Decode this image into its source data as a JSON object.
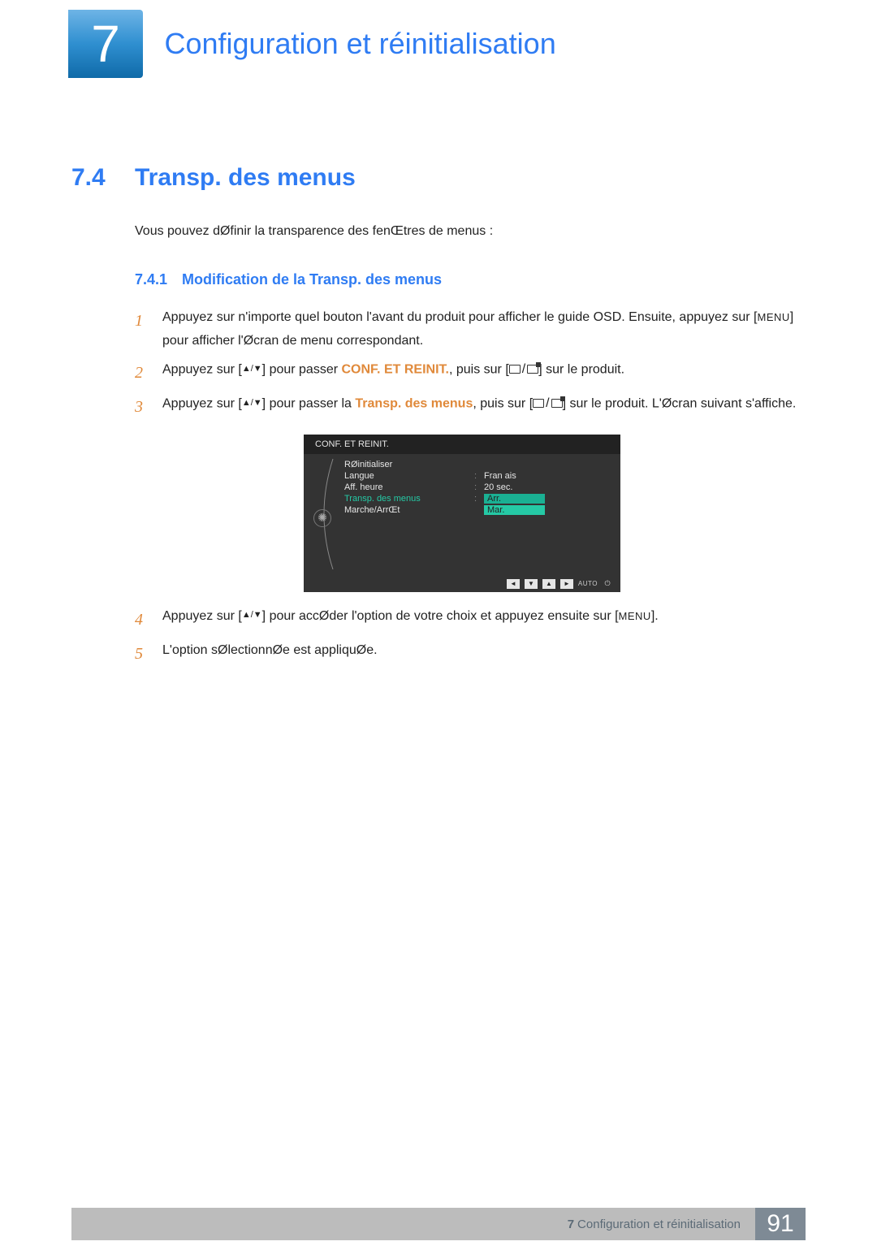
{
  "chapter": {
    "number": "7",
    "title": "Configuration et réinitialisation"
  },
  "section": {
    "number": "7.4",
    "title": "Transp. des menus",
    "intro": "Vous pouvez dØfinir la transparence des fenŒtres de menus :"
  },
  "subsection": {
    "number": "7.4.1",
    "title": "Modification de la Transp. des menus"
  },
  "steps": {
    "s1": {
      "num": "1",
      "a": "Appuyez sur n'importe quel bouton   l'avant du produit pour afficher le guide OSD. Ensuite, appuyez sur [",
      "menu": "MENU",
      "b": "] pour afficher l'Øcran de menu correspondant."
    },
    "s2": {
      "num": "2",
      "a": "Appuyez sur [",
      "b": "] pour passer   ",
      "orange": "CONF. ET REINIT.",
      "c": ", puis sur [",
      "d": "] sur le produit."
    },
    "s3": {
      "num": "3",
      "a": "Appuyez sur [",
      "b": "] pour passer   la ",
      "orange": "Transp. des menus",
      "c": ", puis sur [",
      "d": "] sur le produit. L'Øcran suivant s'affiche."
    },
    "s4": {
      "num": "4",
      "a": "Appuyez sur [",
      "b": "] pour accØder   l'option de votre choix et appuyez ensuite sur [",
      "menu": "MENU",
      "c": "]."
    },
    "s5": {
      "num": "5",
      "text": "L'option sØlectionnØe est appliquØe."
    }
  },
  "osd": {
    "header": "CONF. ET REINIT.",
    "items": {
      "reset": "RØinitialiser",
      "langue": "Langue",
      "aff": "Aff. heure",
      "transp": "Transp. des menus",
      "marche": "Marche/ArrŒt"
    },
    "values": {
      "langue": "Fran ais",
      "aff": "20 sec.",
      "arr": "Arr.",
      "mar": "Mar."
    },
    "footer": {
      "auto": "AUTO"
    }
  },
  "footer": {
    "chapter_num": "7",
    "chapter_title": "Configuration et réinitialisation",
    "page": "91"
  }
}
